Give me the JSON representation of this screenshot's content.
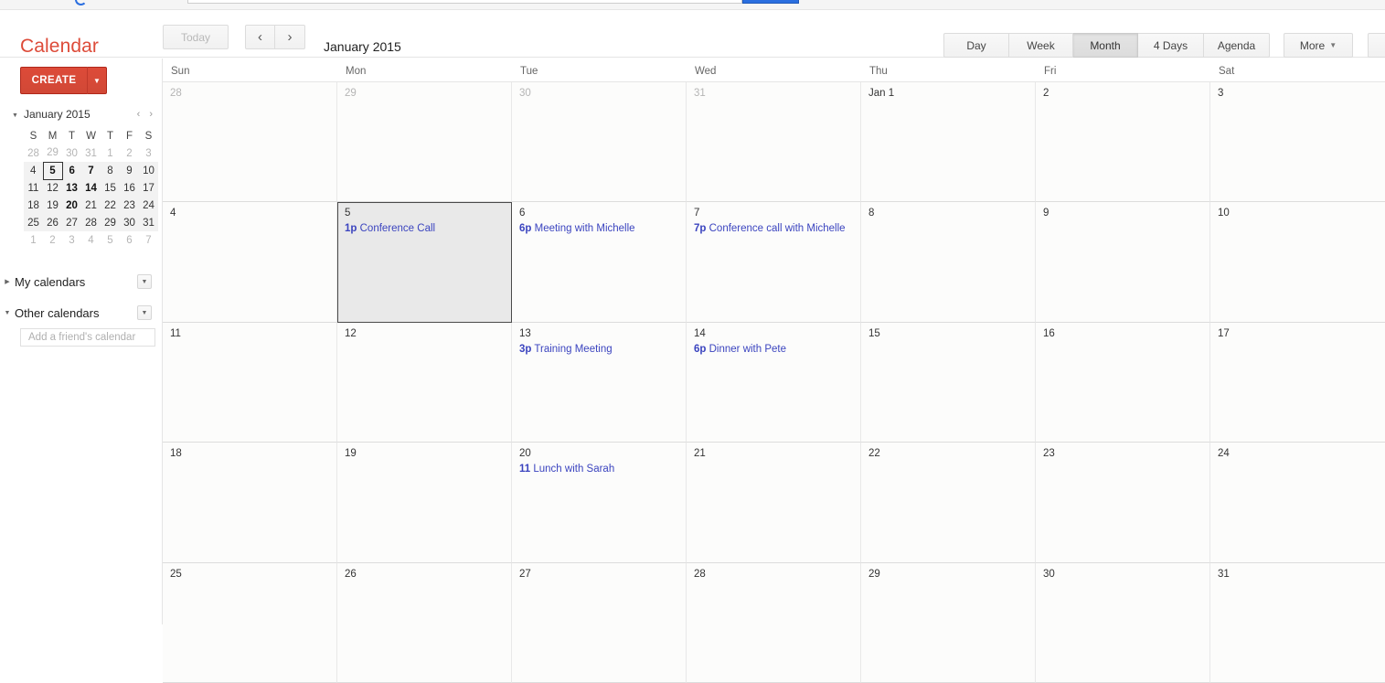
{
  "topstrip": {
    "logo_icon": "google-logo-icon",
    "search_placeholder": "",
    "search_button_label": ""
  },
  "header": {
    "app_title": "Calendar",
    "today_label": "Today",
    "prev_label": "‹",
    "next_label": "›",
    "period_title": "January 2015",
    "views": [
      {
        "label": "Day",
        "active": false,
        "key": "day"
      },
      {
        "label": "Week",
        "active": false,
        "key": "week"
      },
      {
        "label": "Month",
        "active": true,
        "key": "month"
      },
      {
        "label": "4 Days",
        "active": false,
        "key": "4days"
      },
      {
        "label": "Agenda",
        "active": false,
        "key": "agenda"
      }
    ],
    "more_label": "More",
    "more_caret": "▼",
    "edge_button_label": ""
  },
  "sidebar": {
    "create_label": "CREATE",
    "create_caret": "▼",
    "mini_calendar": {
      "collapse_caret": "▼",
      "title": "January 2015",
      "prev_arrow": "‹",
      "next_arrow": "›",
      "weekday_initials": [
        "S",
        "M",
        "T",
        "W",
        "T",
        "F",
        "S"
      ],
      "weeks": [
        [
          {
            "d": "28",
            "outside": true
          },
          {
            "d": "29",
            "outside": true
          },
          {
            "d": "30",
            "outside": true
          },
          {
            "d": "31",
            "outside": true
          },
          {
            "d": "1"
          },
          {
            "d": "2"
          },
          {
            "d": "3"
          }
        ],
        [
          {
            "d": "4"
          },
          {
            "d": "5",
            "today": true
          },
          {
            "d": "6",
            "bold": true
          },
          {
            "d": "7",
            "bold": true
          },
          {
            "d": "8"
          },
          {
            "d": "9"
          },
          {
            "d": "10"
          }
        ],
        [
          {
            "d": "11"
          },
          {
            "d": "12"
          },
          {
            "d": "13",
            "bold": true
          },
          {
            "d": "14",
            "bold": true
          },
          {
            "d": "15"
          },
          {
            "d": "16"
          },
          {
            "d": "17"
          }
        ],
        [
          {
            "d": "18"
          },
          {
            "d": "19"
          },
          {
            "d": "20",
            "bold": true
          },
          {
            "d": "21"
          },
          {
            "d": "22"
          },
          {
            "d": "23"
          },
          {
            "d": "24"
          }
        ],
        [
          {
            "d": "25"
          },
          {
            "d": "26"
          },
          {
            "d": "27"
          },
          {
            "d": "28"
          },
          {
            "d": "29"
          },
          {
            "d": "30"
          },
          {
            "d": "31"
          }
        ],
        [
          {
            "d": "1",
            "outside": true
          },
          {
            "d": "2",
            "outside": true
          },
          {
            "d": "3",
            "outside": true
          },
          {
            "d": "4",
            "outside": true
          },
          {
            "d": "5",
            "outside": true
          },
          {
            "d": "6",
            "outside": true
          },
          {
            "d": "7",
            "outside": true
          }
        ]
      ]
    },
    "my_calendars": {
      "label": "My calendars",
      "caret": "▶",
      "dropdown_caret": "▼"
    },
    "other_calendars": {
      "label": "Other calendars",
      "caret": "▼",
      "dropdown_caret": "▼"
    },
    "add_friend_placeholder": "Add a friend's calendar"
  },
  "main": {
    "day_names": [
      "Sun",
      "Mon",
      "Tue",
      "Wed",
      "Thu",
      "Fri",
      "Sat"
    ],
    "weeks": [
      [
        {
          "label": "28",
          "outside": true,
          "events": []
        },
        {
          "label": "29",
          "outside": true,
          "events": []
        },
        {
          "label": "30",
          "outside": true,
          "events": []
        },
        {
          "label": "31",
          "outside": true,
          "events": []
        },
        {
          "label": "Jan 1",
          "events": []
        },
        {
          "label": "2",
          "events": []
        },
        {
          "label": "3",
          "events": []
        }
      ],
      [
        {
          "label": "4",
          "events": []
        },
        {
          "label": "5",
          "selected": true,
          "events": [
            {
              "time": "1p",
              "title": "Conference Call"
            }
          ]
        },
        {
          "label": "6",
          "events": [
            {
              "time": "6p",
              "title": "Meeting with Michelle"
            }
          ]
        },
        {
          "label": "7",
          "events": [
            {
              "time": "7p",
              "title": "Conference call with Michelle"
            }
          ]
        },
        {
          "label": "8",
          "events": []
        },
        {
          "label": "9",
          "events": []
        },
        {
          "label": "10",
          "events": []
        }
      ],
      [
        {
          "label": "11",
          "events": []
        },
        {
          "label": "12",
          "events": []
        },
        {
          "label": "13",
          "events": [
            {
              "time": "3p",
              "title": "Training Meeting"
            }
          ]
        },
        {
          "label": "14",
          "events": [
            {
              "time": "6p",
              "title": "Dinner with Pete"
            }
          ]
        },
        {
          "label": "15",
          "events": []
        },
        {
          "label": "16",
          "events": []
        },
        {
          "label": "17",
          "events": []
        }
      ],
      [
        {
          "label": "18",
          "events": []
        },
        {
          "label": "19",
          "events": []
        },
        {
          "label": "20",
          "events": [
            {
              "time": "11",
              "title": "Lunch with Sarah"
            }
          ]
        },
        {
          "label": "21",
          "events": []
        },
        {
          "label": "22",
          "events": []
        },
        {
          "label": "23",
          "events": []
        },
        {
          "label": "24",
          "events": []
        }
      ],
      [
        {
          "label": "25",
          "events": []
        },
        {
          "label": "26",
          "events": []
        },
        {
          "label": "27",
          "events": []
        },
        {
          "label": "28",
          "events": []
        },
        {
          "label": "29",
          "events": []
        },
        {
          "label": "30",
          "events": []
        },
        {
          "label": "31",
          "events": []
        }
      ]
    ]
  },
  "colors": {
    "brand_red": "#dd4b39",
    "event_blue": "#3b44bf",
    "selected_cell_bg": "#e9e9e9",
    "grid_line": "#e8e8e8",
    "cell_bg": "#fcfcfb"
  }
}
